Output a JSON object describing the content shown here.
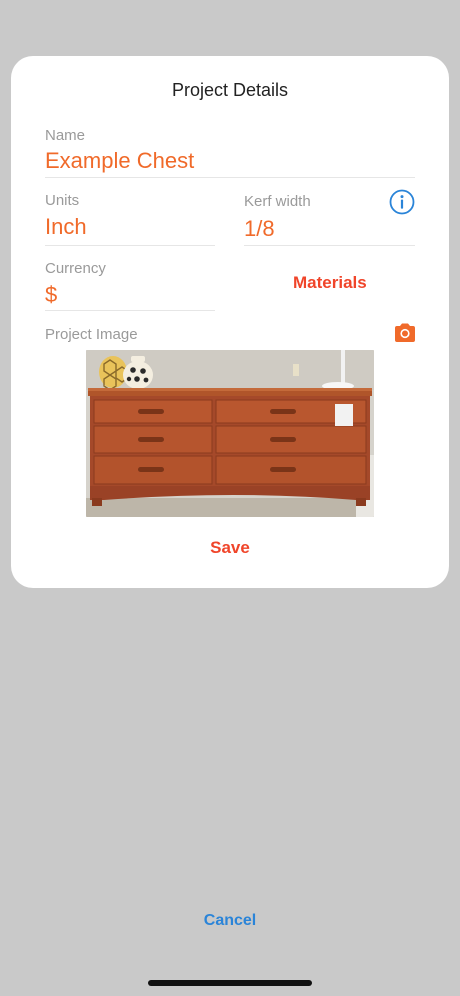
{
  "dialog": {
    "title": "Project Details",
    "name": {
      "label": "Name",
      "value": "Example Chest"
    },
    "units": {
      "label": "Units",
      "value": "Inch"
    },
    "kerf": {
      "label": "Kerf width",
      "value": "1/8"
    },
    "currency": {
      "label": "Currency",
      "value": "$"
    },
    "materials_label": "Materials",
    "project_image_label": "Project Image",
    "save_label": "Save",
    "icons": {
      "info": "info-icon",
      "camera": "camera-icon"
    }
  },
  "footer": {
    "cancel_label": "Cancel"
  },
  "colors": {
    "accent_orange": "#f06a2a",
    "accent_red": "#f0452a",
    "link_blue": "#2a84d8",
    "background": "#c9c9c9"
  }
}
